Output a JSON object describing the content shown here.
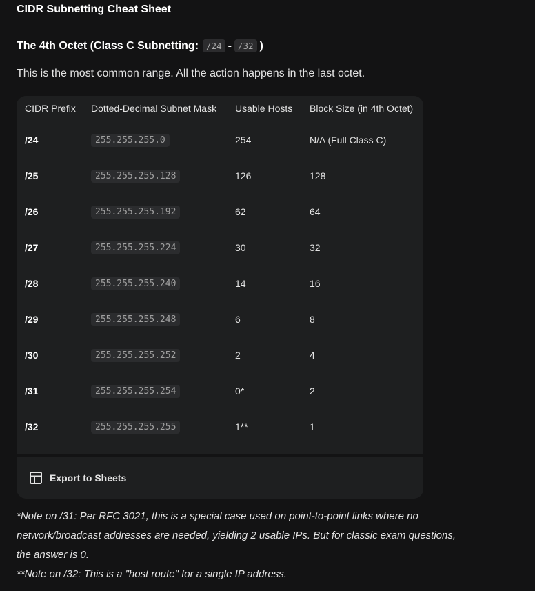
{
  "document": {
    "title": "CIDR Subnetting Cheat Sheet"
  },
  "section": {
    "heading_prefix": "The 4th Octet (Class C Subnetting:",
    "code_start": "/24",
    "separator": "-",
    "code_end": "/32",
    "heading_suffix": ")",
    "intro": "This is the most common range. All the action happens in the last octet."
  },
  "table": {
    "headers": [
      "CIDR Prefix",
      "Dotted-Decimal Subnet Mask",
      "Usable Hosts",
      "Block Size (in 4th Octet)"
    ],
    "rows": [
      {
        "prefix": "/24",
        "mask": "255.255.255.0",
        "hosts": "254",
        "block": "N/A (Full Class C)"
      },
      {
        "prefix": "/25",
        "mask": "255.255.255.128",
        "hosts": "126",
        "block": "128"
      },
      {
        "prefix": "/26",
        "mask": "255.255.255.192",
        "hosts": "62",
        "block": "64"
      },
      {
        "prefix": "/27",
        "mask": "255.255.255.224",
        "hosts": "30",
        "block": "32"
      },
      {
        "prefix": "/28",
        "mask": "255.255.255.240",
        "hosts": "14",
        "block": "16"
      },
      {
        "prefix": "/29",
        "mask": "255.255.255.248",
        "hosts": "6",
        "block": "8"
      },
      {
        "prefix": "/30",
        "mask": "255.255.255.252",
        "hosts": "2",
        "block": "4"
      },
      {
        "prefix": "/31",
        "mask": "255.255.255.254",
        "hosts": "0*",
        "block": "2"
      },
      {
        "prefix": "/32",
        "mask": "255.255.255.255",
        "hosts": "1**",
        "block": "1"
      }
    ],
    "export_label": "Export to Sheets",
    "export_icon": "table-grid-icon"
  },
  "notes": {
    "note31_lines": [
      "*Note on /31: Per RFC 3021, this is a special case used on point-to-point links where no",
      "network/broadcast addresses are needed, yielding 2 usable IPs. But for classic exam questions,",
      "the answer is 0."
    ],
    "note32": "**Note on /32: This is a \"host route\" for a single IP address."
  },
  "colors": {
    "background": "#131314",
    "card": "#1e1f20",
    "text": "#e3e3e3",
    "code_text": "#a0a0a0"
  }
}
